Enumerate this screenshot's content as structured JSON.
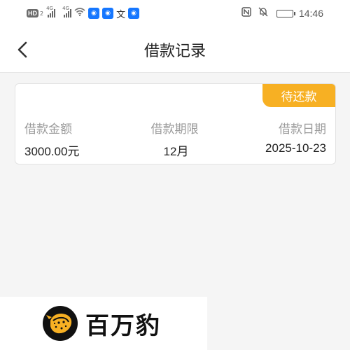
{
  "status_bar": {
    "hd_label": "HD",
    "hd_sub": "2",
    "signal_tag_1": "4G",
    "signal_tag_2": "4G",
    "wen_char": "文",
    "time": "14:46"
  },
  "nav": {
    "title": "借款记录"
  },
  "loan_record": {
    "status": "待还款",
    "amount_label": "借款金额",
    "amount_value": "3000.00元",
    "term_label": "借款期限",
    "term_value": "12月",
    "date_label": "借款日期",
    "date_value": "2025-10-23"
  },
  "brand": {
    "name": "百万豹"
  },
  "colors": {
    "accent": "#f7b023",
    "badge_blue": "#1677ff"
  }
}
